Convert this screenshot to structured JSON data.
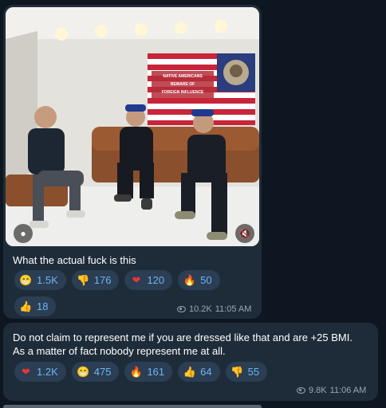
{
  "messages": [
    {
      "text": "What the actual fuck is this",
      "media": {
        "flag_lines": [
          "NATIVE AMERICANS",
          "BEWARE OF",
          "FOREIGN INFLUENCE"
        ]
      },
      "reactions": [
        {
          "emoji": "grin",
          "count": "1.5K"
        },
        {
          "emoji": "thumbs-down",
          "count": "176"
        },
        {
          "emoji": "heart",
          "count": "120"
        },
        {
          "emoji": "fire",
          "count": "50"
        },
        {
          "emoji": "thumbs-up",
          "count": "18"
        }
      ],
      "views": "10.2K",
      "time": "11:05 AM"
    },
    {
      "text_line1": "Do not claim to represent me if you are dressed like that and are +25 BMI.",
      "text_line2": "As a matter of fact nobody represent me at all.",
      "reactions": [
        {
          "emoji": "heart",
          "count": "1.2K"
        },
        {
          "emoji": "grin",
          "count": "475"
        },
        {
          "emoji": "fire",
          "count": "161"
        },
        {
          "emoji": "thumbs-up",
          "count": "64"
        },
        {
          "emoji": "thumbs-down",
          "count": "55"
        }
      ],
      "views": "9.8K",
      "time": "11:06 AM"
    }
  ],
  "colors": {
    "background": "#0e1621",
    "bubble": "#1e2c3a",
    "reaction_pill": "#2b3e53",
    "reaction_count": "#6fb5f0",
    "meta": "#9aa6b3"
  }
}
